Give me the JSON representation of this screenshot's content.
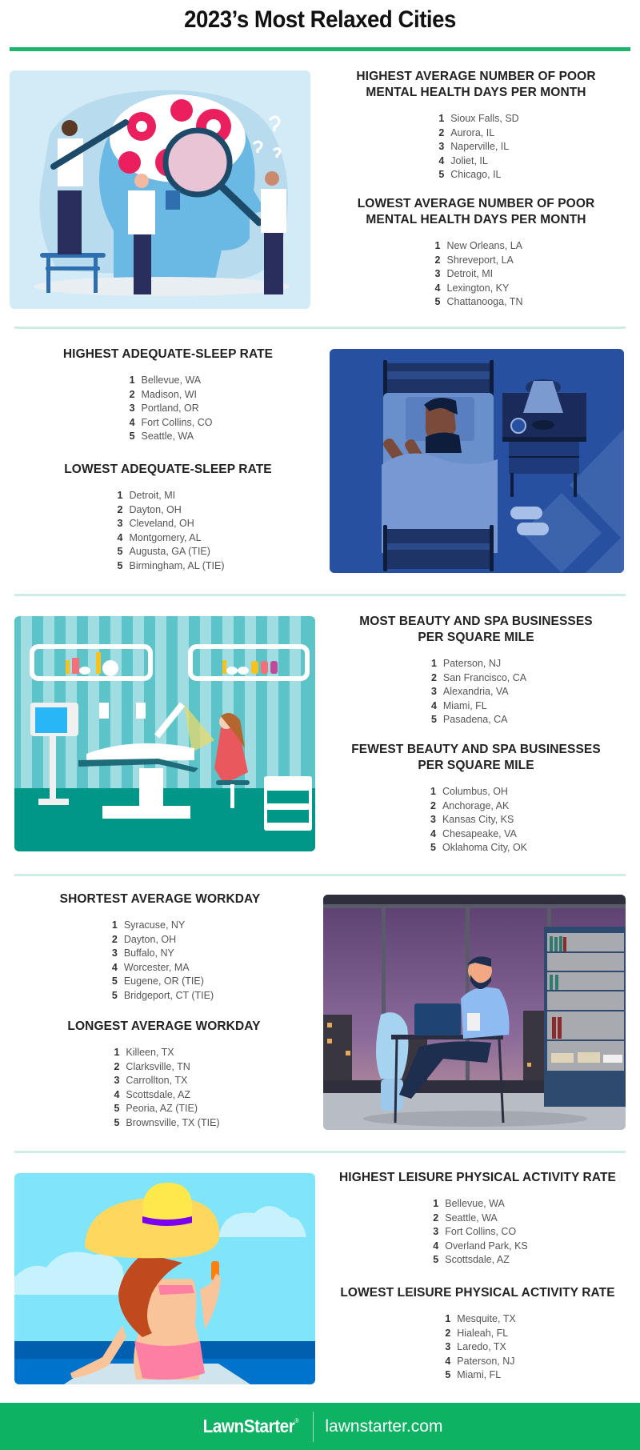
{
  "header": {
    "title": "2023’s Most Relaxed Cities"
  },
  "colors": {
    "accent_green": "#1fb46b",
    "footer_green": "#0db262",
    "divider_mint": "#cdeee0",
    "heading_text": "#222222",
    "city_text": "#555555"
  },
  "sections": [
    {
      "illustration": "scientists-examining-brain-gears",
      "lists": [
        {
          "heading": "HIGHEST AVERAGE NUMBER OF POOR MENTAL HEALTH DAYS PER MONTH",
          "items": [
            {
              "rank": "1",
              "city": "Sioux Falls, SD"
            },
            {
              "rank": "2",
              "city": "Aurora, IL"
            },
            {
              "rank": "3",
              "city": "Naperville, IL"
            },
            {
              "rank": "4",
              "city": "Joliet, IL"
            },
            {
              "rank": "5",
              "city": "Chicago, IL"
            }
          ]
        },
        {
          "heading": "LOWEST AVERAGE NUMBER OF POOR MENTAL HEALTH DAYS PER MONTH",
          "items": [
            {
              "rank": "1",
              "city": "New Orleans, LA"
            },
            {
              "rank": "2",
              "city": "Shreveport, LA"
            },
            {
              "rank": "3",
              "city": "Detroit, MI"
            },
            {
              "rank": "4",
              "city": "Lexington, KY"
            },
            {
              "rank": "5",
              "city": "Chattanooga, TN"
            }
          ]
        }
      ]
    },
    {
      "illustration": "man-sleeping-in-bed",
      "lists": [
        {
          "heading": "HIGHEST ADEQUATE-SLEEP RATE",
          "items": [
            {
              "rank": "1",
              "city": "Bellevue, WA"
            },
            {
              "rank": "2",
              "city": "Madison, WI"
            },
            {
              "rank": "3",
              "city": "Portland, OR"
            },
            {
              "rank": "4",
              "city": "Fort Collins, CO"
            },
            {
              "rank": "5",
              "city": "Seattle, WA"
            }
          ]
        },
        {
          "heading": "LOWEST ADEQUATE-SLEEP RATE",
          "items": [
            {
              "rank": "1",
              "city": "Detroit, MI"
            },
            {
              "rank": "2",
              "city": "Dayton, OH"
            },
            {
              "rank": "3",
              "city": "Cleveland, OH"
            },
            {
              "rank": "4",
              "city": "Montgomery, AL"
            },
            {
              "rank": "5",
              "city": "Augusta, GA (TIE)"
            },
            {
              "rank": "5",
              "city": "Birmingham, AL (TIE)"
            }
          ]
        }
      ]
    },
    {
      "illustration": "beauty-spa-facial-treatment",
      "lists": [
        {
          "heading": "MOST BEAUTY AND SPA BUSINESSES PER SQUARE MILE",
          "items": [
            {
              "rank": "1",
              "city": "Paterson, NJ"
            },
            {
              "rank": "2",
              "city": "San Francisco, CA"
            },
            {
              "rank": "3",
              "city": "Alexandria, VA"
            },
            {
              "rank": "4",
              "city": "Miami, FL"
            },
            {
              "rank": "5",
              "city": "Pasadena, CA"
            }
          ]
        },
        {
          "heading": "FEWEST BEAUTY AND SPA BUSINESSES PER SQUARE MILE",
          "items": [
            {
              "rank": "1",
              "city": "Columbus, OH"
            },
            {
              "rank": "2",
              "city": "Anchorage, AK"
            },
            {
              "rank": "3",
              "city": "Kansas City, KS"
            },
            {
              "rank": "4",
              "city": "Chesapeake, VA"
            },
            {
              "rank": "5",
              "city": "Oklahoma City, OK"
            }
          ]
        }
      ]
    },
    {
      "illustration": "man-working-laptop-at-night",
      "lists": [
        {
          "heading": "SHORTEST AVERAGE WORKDAY",
          "items": [
            {
              "rank": "1",
              "city": "Syracuse, NY"
            },
            {
              "rank": "2",
              "city": "Dayton, OH"
            },
            {
              "rank": "3",
              "city": "Buffalo, NY"
            },
            {
              "rank": "4",
              "city": "Worcester, MA"
            },
            {
              "rank": "5",
              "city": "Eugene, OR (TIE)"
            },
            {
              "rank": "5",
              "city": "Bridgeport, CT (TIE)"
            }
          ]
        },
        {
          "heading": "LONGEST AVERAGE WORKDAY",
          "items": [
            {
              "rank": "1",
              "city": "Killeen, TX"
            },
            {
              "rank": "2",
              "city": "Clarksville, TN"
            },
            {
              "rank": "3",
              "city": "Carrollton, TX"
            },
            {
              "rank": "4",
              "city": "Scottsdale, AZ"
            },
            {
              "rank": "5",
              "city": "Peoria, AZ (TIE)"
            },
            {
              "rank": "5",
              "city": "Brownsville, TX (TIE)"
            }
          ]
        }
      ]
    },
    {
      "illustration": "woman-relaxing-by-pool",
      "lists": [
        {
          "heading": "HIGHEST LEISURE PHYSICAL ACTIVITY RATE",
          "items": [
            {
              "rank": "1",
              "city": "Bellevue, WA"
            },
            {
              "rank": "2",
              "city": "Seattle, WA"
            },
            {
              "rank": "3",
              "city": "Fort Collins, CO"
            },
            {
              "rank": "4",
              "city": "Overland Park, KS"
            },
            {
              "rank": "5",
              "city": "Scottsdale, AZ"
            }
          ]
        },
        {
          "heading": "LOWEST LEISURE PHYSICAL ACTIVITY RATE",
          "items": [
            {
              "rank": "1",
              "city": "Mesquite, TX"
            },
            {
              "rank": "2",
              "city": "Hialeah, FL"
            },
            {
              "rank": "3",
              "city": "Laredo, TX"
            },
            {
              "rank": "4",
              "city": "Paterson, NJ"
            },
            {
              "rank": "5",
              "city": "Miami, FL"
            }
          ]
        }
      ]
    }
  ],
  "footer": {
    "brand": "LawnStarter",
    "registered_mark": "®",
    "url": "lawnstarter.com"
  }
}
